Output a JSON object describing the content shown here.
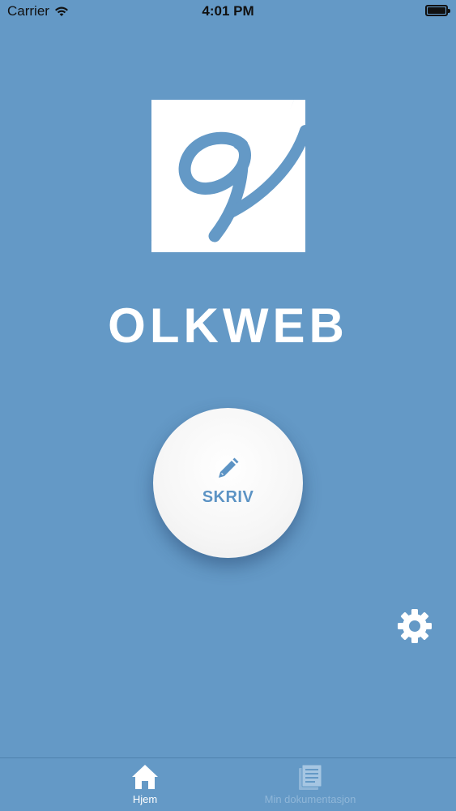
{
  "status_bar": {
    "carrier": "Carrier",
    "time": "4:01 PM"
  },
  "app": {
    "title": "OLKWEB"
  },
  "write_button": {
    "label": "SKRIV",
    "icon": "pencil-icon"
  },
  "settings": {
    "icon": "gear-icon"
  },
  "tab_bar": {
    "tabs": [
      {
        "label": "Hjem",
        "icon": "home-icon",
        "active": true
      },
      {
        "label": "Min dokumentasjon",
        "icon": "document-icon",
        "active": false
      }
    ]
  },
  "colors": {
    "background": "#6499c6",
    "accent": "#5c93c4",
    "inactive_tab": "#8fb6d8"
  }
}
